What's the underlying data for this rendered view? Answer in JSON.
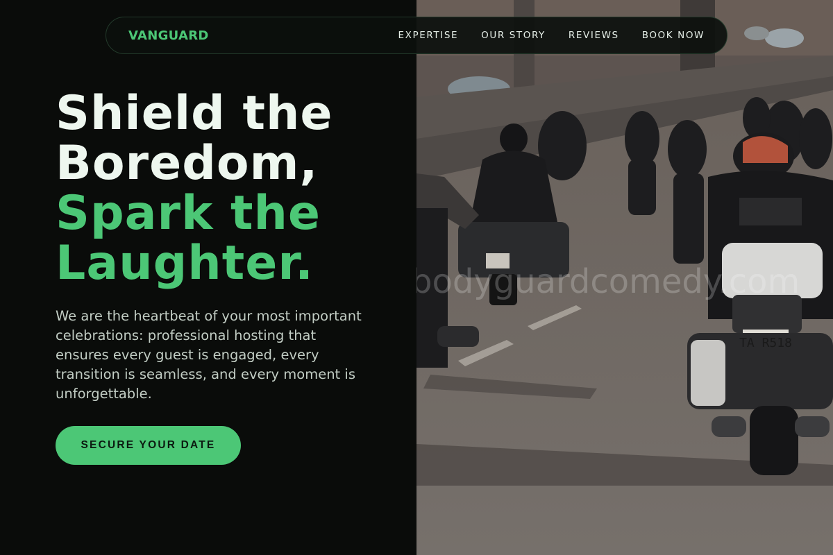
{
  "nav": {
    "brand": "VANGUARD",
    "links": [
      "EXPERTISE",
      "OUR STORY",
      "REVIEWS",
      "BOOK NOW"
    ]
  },
  "hero": {
    "title_line1": "Shield the",
    "title_line2": "Boredom,",
    "title_accent1": "Spark the",
    "title_accent2": "Laughter.",
    "description": "We are the heartbeat of your most important celebrations: professional hosting that ensures every guest is engaged, every transition is seamless, and every moment is unforgettable.",
    "cta_label": "SECURE YOUR DATE"
  },
  "image": {
    "subject": "motorcycle-convoy-photo",
    "watermark": "bodyguardcomedy.com",
    "plate_text": "TA R518"
  },
  "colors": {
    "accent": "#4cc776",
    "background": "#0a0c0a",
    "heading": "#eef7ef",
    "body_text": "#c2cdc4"
  }
}
